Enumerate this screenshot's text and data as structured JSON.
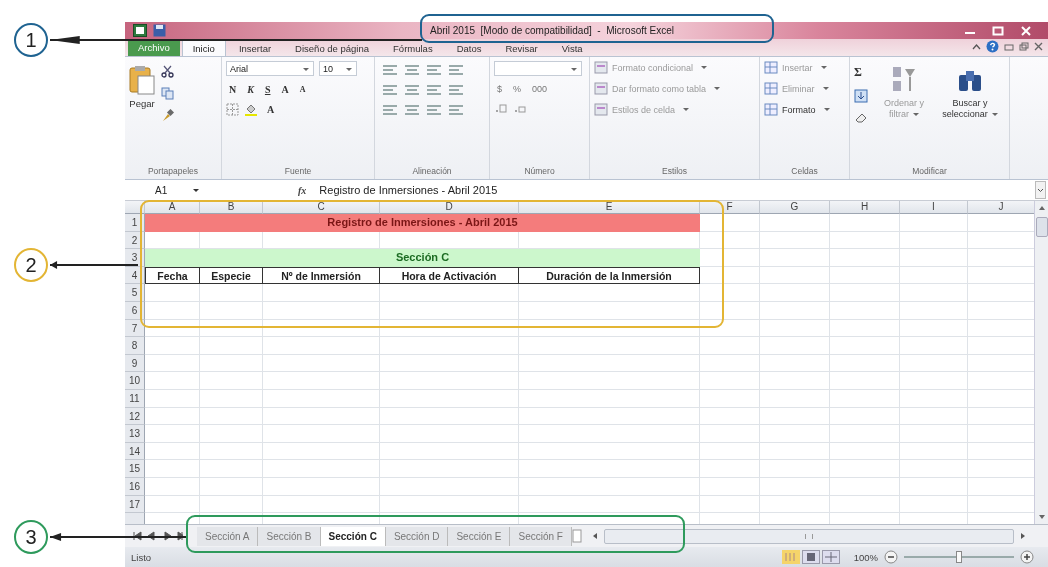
{
  "window": {
    "title": "Abril 2015  [Modo de compatibilidad]  -  Microsoft Excel"
  },
  "ribbon_tabs": [
    {
      "label": "Archivo",
      "kind": "file",
      "selected": false
    },
    {
      "label": "Inicio",
      "kind": "tab",
      "selected": true
    },
    {
      "label": "Insertar",
      "kind": "tab",
      "selected": false
    },
    {
      "label": "Diseño de página",
      "kind": "tab",
      "selected": false
    },
    {
      "label": "Fórmulas",
      "kind": "tab",
      "selected": false
    },
    {
      "label": "Datos",
      "kind": "tab",
      "selected": false
    },
    {
      "label": "Revisar",
      "kind": "tab",
      "selected": false
    },
    {
      "label": "Vista",
      "kind": "tab",
      "selected": false
    }
  ],
  "ribbon_groups": [
    {
      "kind": "clipboard",
      "label": "Portapapeles",
      "paste": "Pegar"
    },
    {
      "kind": "font",
      "label": "Fuente",
      "font_name": "Arial",
      "font_size": "10",
      "format_buttons": [
        "N",
        "K",
        "S"
      ],
      "size_buttons": [
        "A",
        "A"
      ],
      "color_button": "A"
    },
    {
      "kind": "alignment",
      "label": "Alineación"
    },
    {
      "kind": "number",
      "label": "Número",
      "buttons": [
        "$",
        "%",
        "000"
      ]
    },
    {
      "kind": "styles",
      "label": "Estilos",
      "items": [
        {
          "label": "Formato condicional",
          "disabled": true
        },
        {
          "label": "Dar formato como tabla",
          "disabled": true
        },
        {
          "label": "Estilos de celda",
          "disabled": true
        }
      ]
    },
    {
      "kind": "cells",
      "label": "Celdas",
      "items": [
        {
          "label": "Insertar",
          "disabled": true
        },
        {
          "label": "Eliminar",
          "disabled": true
        },
        {
          "label": "Formato",
          "disabled": false
        }
      ]
    },
    {
      "kind": "editing",
      "label": "Modificar",
      "sum": "Σ",
      "items": [
        {
          "label": "Ordenar y filtrar",
          "disabled": true
        },
        {
          "label": "Buscar y seleccionar",
          "disabled": false
        }
      ]
    }
  ],
  "formula_bar": {
    "name_box": "A1",
    "fx": "fx",
    "formula": "Registro de Inmersiones - Abril 2015"
  },
  "sheet": {
    "columns": [
      "A",
      "B",
      "C",
      "D",
      "E",
      "F",
      "G",
      "H",
      "I",
      "J"
    ],
    "rows": [
      {
        "label": "1",
        "band": {
          "kind": "title",
          "text": "Registro de Inmersiones - Abril 2015"
        }
      },
      {
        "label": "2"
      },
      {
        "label": "3",
        "band": {
          "kind": "section",
          "text": "Sección C"
        }
      },
      {
        "label": "4",
        "cells": [
          "Fecha",
          "Especie",
          "Nº de Inmersión",
          "Hora de Activación",
          "Duración de la Inmersión"
        ]
      },
      {
        "label": "5"
      },
      {
        "label": "6"
      },
      {
        "label": "7"
      },
      {
        "label": "8"
      },
      {
        "label": "9"
      },
      {
        "label": "10"
      },
      {
        "label": "11"
      },
      {
        "label": "12"
      },
      {
        "label": "13"
      },
      {
        "label": "14"
      },
      {
        "label": "15"
      },
      {
        "label": "16"
      },
      {
        "label": "17"
      }
    ]
  },
  "sheet_tabs": [
    {
      "label": "Sección A",
      "selected": false
    },
    {
      "label": "Sección B",
      "selected": false
    },
    {
      "label": "Sección C",
      "selected": true
    },
    {
      "label": "Sección D",
      "selected": false
    },
    {
      "label": "Sección E",
      "selected": false
    },
    {
      "label": "Sección F",
      "selected": false
    }
  ],
  "status_bar": {
    "status": "Listo",
    "zoom": "100%",
    "zoom_level": {
      "level": 0.5
    }
  },
  "callouts": [
    {
      "label": "1",
      "color": "#1f6391"
    },
    {
      "label": "2",
      "color": "#e3b534"
    },
    {
      "label": "3",
      "color": "#2e9a5c"
    }
  ]
}
